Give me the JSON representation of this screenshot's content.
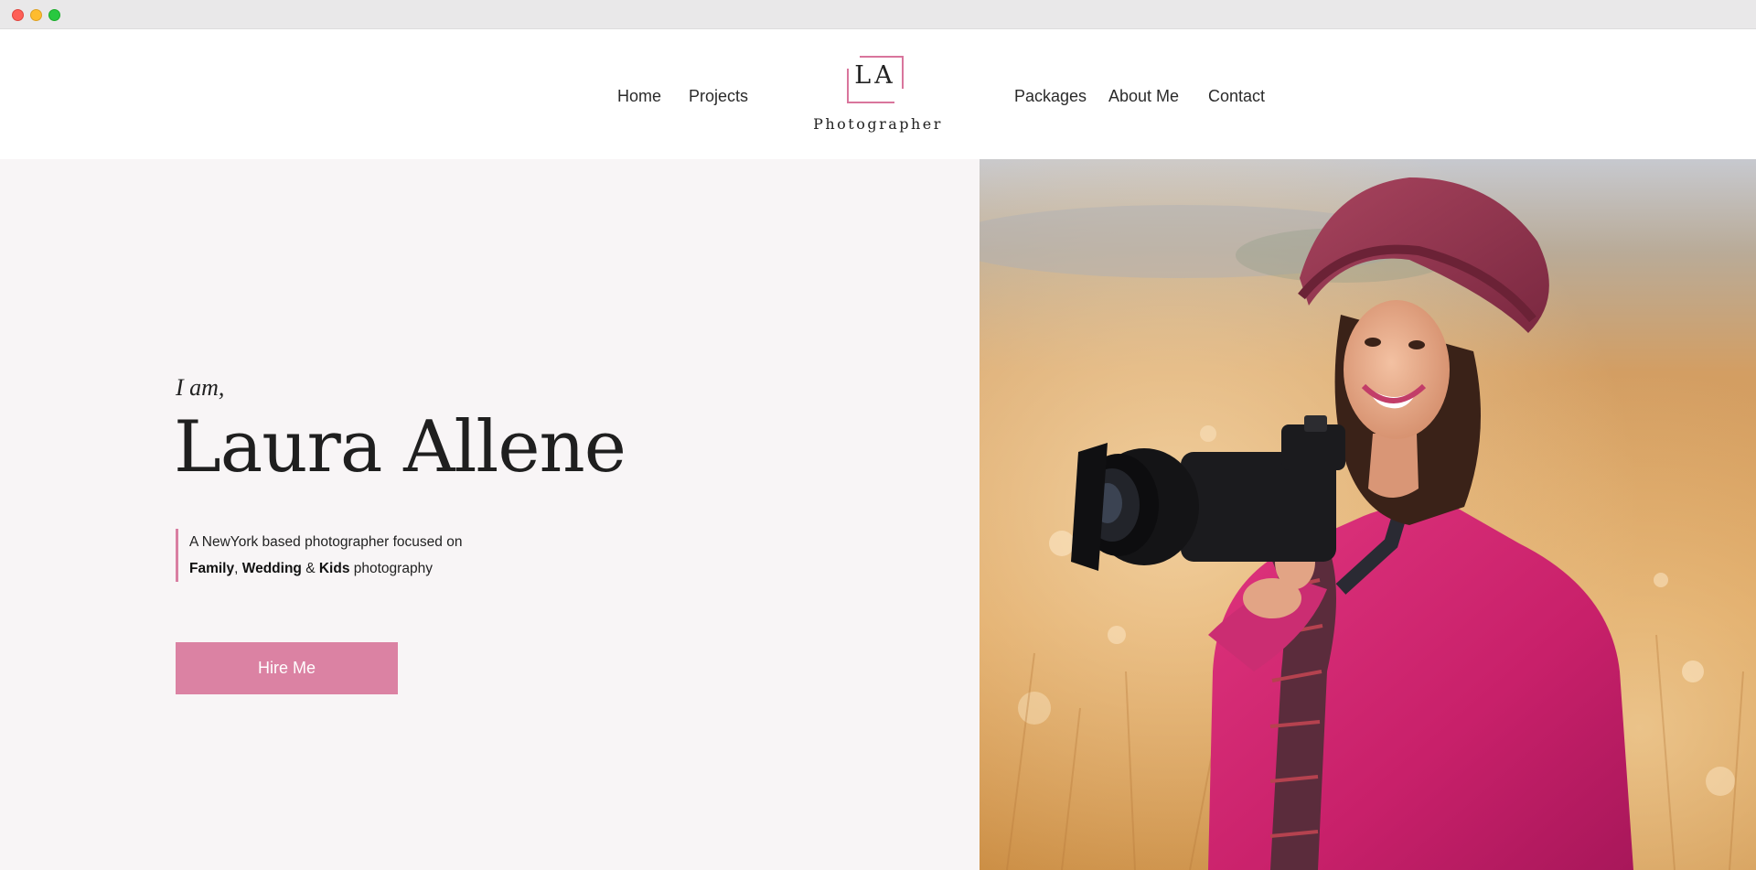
{
  "nav": {
    "home": "Home",
    "projects": "Projects",
    "packages": "Packages",
    "about": "About Me",
    "contact": "Contact"
  },
  "logo": {
    "initials": "LA",
    "subtitle": "Photographer"
  },
  "hero": {
    "intro": "I am,",
    "name": "Laura Allene",
    "tagline_line1": "A NewYork based photographer focused on",
    "tag_family": "Family",
    "tag_sep1": ",",
    "tag_wedding": "Wedding",
    "tag_amp": "&",
    "tag_kids": "Kids",
    "tag_suffix": "photography",
    "button_label": "Hire Me"
  },
  "colors": {
    "accent": "#db82a3",
    "hero_background": "#f8f5f6"
  }
}
